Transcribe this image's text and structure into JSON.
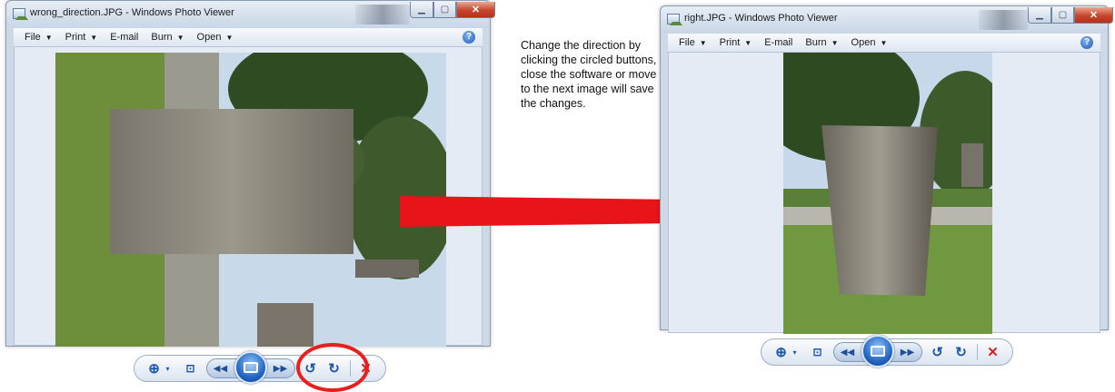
{
  "left_window": {
    "title": "wrong_direction.JPG - Windows Photo Viewer",
    "menu": [
      {
        "label": "File",
        "has_arrow": true
      },
      {
        "label": "Print",
        "has_arrow": true
      },
      {
        "label": "E-mail",
        "has_arrow": false
      },
      {
        "label": "Burn",
        "has_arrow": true
      },
      {
        "label": "Open",
        "has_arrow": true
      }
    ],
    "help_icon": "?",
    "controls": {
      "zoom_icon": "zoom-icon",
      "fit_icon": "actual-size-icon",
      "prev_icon": "previous-icon",
      "slideshow_icon": "slideshow-icon",
      "next_icon": "next-icon",
      "rotate_ccw_icon": "rotate-counterclockwise-icon",
      "rotate_cw_icon": "rotate-clockwise-icon",
      "delete_icon": "delete-icon"
    }
  },
  "right_window": {
    "title": "right.JPG - Windows Photo Viewer",
    "menu": [
      {
        "label": "File",
        "has_arrow": true
      },
      {
        "label": "Print",
        "has_arrow": true
      },
      {
        "label": "E-mail",
        "has_arrow": false
      },
      {
        "label": "Burn",
        "has_arrow": true
      },
      {
        "label": "Open",
        "has_arrow": true
      }
    ],
    "help_icon": "?"
  },
  "instruction_text": "Change the direction by clicking the circled buttons, close the software or move to the next image will save the changes.",
  "colors": {
    "arrow": "#e8141a",
    "highlight_circle": "#e81f1f",
    "window_frame": "#cfd9e6",
    "accent_blue": "#1e57a8"
  }
}
